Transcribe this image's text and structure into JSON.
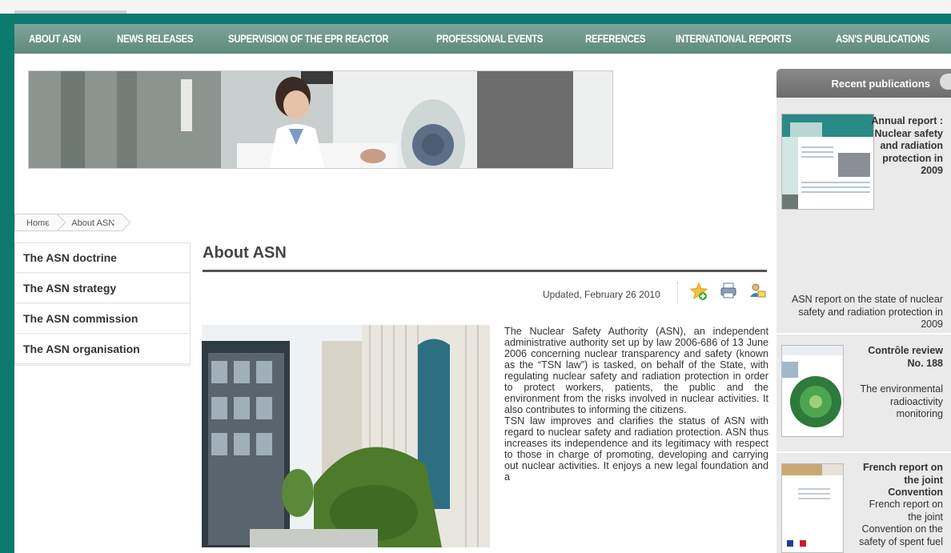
{
  "nav": {
    "items": [
      "ABOUT ASN",
      "NEWS RELEASES",
      "SUPERVISION OF THE EPR REACTOR",
      "PROFESSIONAL EVENTS",
      "REFERENCES",
      "INTERNATIONAL REPORTS",
      "ASN'S PUBLICATIONS"
    ]
  },
  "breadcrumb": [
    "Home",
    "About ASN"
  ],
  "sidebar": {
    "items": [
      "The ASN doctrine",
      "The ASN strategy",
      "The ASN commission",
      "The ASN organisation"
    ]
  },
  "main": {
    "title": "About ASN",
    "updated": "Updated, February 26 2010",
    "tools": [
      "star-add-icon",
      "print-icon",
      "send-to-friend-icon"
    ],
    "body_p1": "The Nuclear Safety Authority (ASN), an independent administrative authority set up by law 2006-686 of 13 June 2006 concerning nuclear transparency and safety (known as the “TSN law”) is tasked, on behalf of the State, with regulating nuclear safety and radiation protection in order to protect workers, patients, the public and the environment from the risks involved in nuclear activities. It also contributes to informing the citizens.",
    "body_p2": "TSN law improves and clarifies the status of ASN with regard to nuclear safety and radiation protection. ASN thus increases its independence and its legitimacy with respect to those in charge of promoting, developing and carrying out nuclear activities. It enjoys a new legal foundation and a"
  },
  "recent": {
    "heading": "Recent publications",
    "pubs": [
      {
        "title": "Annual report : Nuclear safety and radiation protection in 2009",
        "desc": "ASN report on the state of nuclear safety and radiation protection in 2009"
      },
      {
        "title": "Contrôle review No. 188",
        "desc": "The environmental radioactivity monitoring"
      },
      {
        "title": "French report on the joint Convention",
        "desc": "French report on the joint Convention on the safety of spent fuel"
      }
    ]
  },
  "colors": {
    "frame": "#0d7a70",
    "nav": "#6a9488",
    "panel_header": "#7a7a7a"
  }
}
